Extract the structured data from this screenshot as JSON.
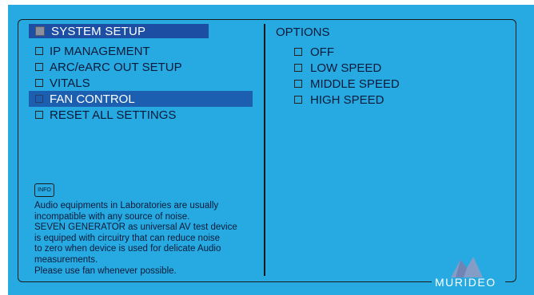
{
  "menu": {
    "header": "SYSTEM SETUP",
    "items": [
      {
        "label": "IP MANAGEMENT",
        "selected": false
      },
      {
        "label": "ARC/eARC OUT SETUP",
        "selected": false
      },
      {
        "label": "VITALS",
        "selected": false
      },
      {
        "label": "FAN CONTROL",
        "selected": true
      },
      {
        "label": "RESET ALL SETTINGS",
        "selected": false
      }
    ]
  },
  "options": {
    "title": "OPTIONS",
    "items": [
      {
        "label": "OFF"
      },
      {
        "label": "LOW SPEED"
      },
      {
        "label": "MIDDLE SPEED"
      },
      {
        "label": "HIGH SPEED"
      }
    ]
  },
  "info": {
    "badge": "INFO",
    "lines": [
      "Audio equipments in Laboratories are usually",
      "incompatible with any source of noise.",
      "SEVEN GENERATOR as universal AV test device",
      "is equiped with circuitry that can reduce noise",
      "to zero when device is used for delicate Audio",
      "measurements.",
      "Please use fan whenever possible."
    ]
  },
  "brand": {
    "logo_text": "MURIDEO"
  },
  "colors": {
    "screen_bg": "#27aae1",
    "header_bg": "#1c4fa3",
    "selected_bg": "#1c5fb0",
    "text": "#0a1a3a"
  }
}
